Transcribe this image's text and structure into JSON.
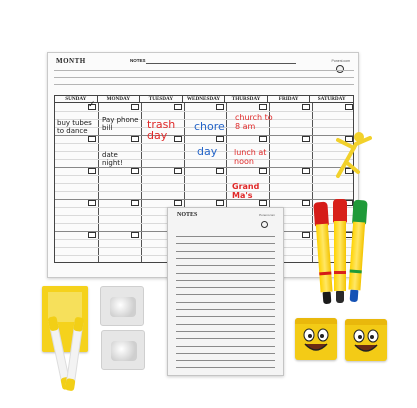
{
  "calendar": {
    "month_label": "MONTH",
    "notes_label": "NOTES",
    "brand": "Poneni.com",
    "days": [
      "SUNDAY",
      "MONDAY",
      "TUESDAY",
      "WEDNESDAY",
      "THURSDAY",
      "FRIDAY",
      "SATURDAY"
    ],
    "entries": {
      "sunday": "buy tubes to dance",
      "monday_1": "Pay phone bill",
      "monday_2": "date night!",
      "tuesday": "trash day",
      "wednesday_1": "chore",
      "wednesday_2": "day",
      "thursday_1": "church to 8 am",
      "thursday_2": "lunch at noon",
      "thursday_3": "Grand Ma's"
    }
  },
  "notes_pad": {
    "title": "NOTES",
    "brand": "Poneni.com"
  },
  "colors": {
    "ink_black": "#1a1a1a",
    "ink_red": "#e02828",
    "ink_blue": "#2464c8",
    "marker_red": "#d51b17",
    "marker_green": "#1f9a39",
    "marker_blue": "#1552b5",
    "yellow": "#f3cb16"
  },
  "icons": {
    "smiley_eraser": "smiley-face-icon",
    "stick_figure": "yellow-stick-figure-icon"
  }
}
